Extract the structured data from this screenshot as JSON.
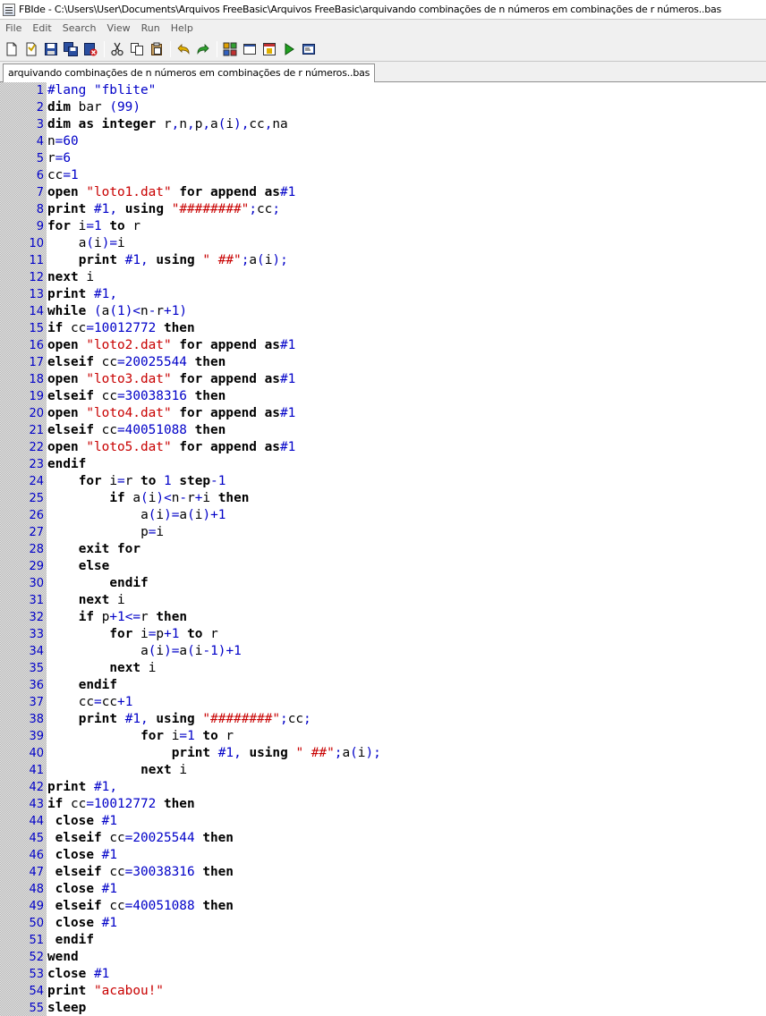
{
  "window": {
    "title": "FBIde - C:\\Users\\User\\Documents\\Arquivos FreeBasic\\Arquivos FreeBasic\\arquivando combinações de n números em combinações de r números..bas"
  },
  "menu": [
    "File",
    "Edit",
    "Search",
    "View",
    "Run",
    "Help"
  ],
  "toolbar": {
    "buttons": [
      "new-file-icon",
      "open-file-icon",
      "save-icon",
      "save-all-icon",
      "close-file-icon",
      "cut-icon",
      "copy-icon",
      "paste-icon",
      "undo-icon",
      "redo-icon",
      "compile-icon",
      "run-window-icon",
      "compile-run-icon",
      "run-icon",
      "console-icon"
    ]
  },
  "tab": {
    "label": "arquivando combinações de n números em combinações de r números..bas"
  },
  "colors": {
    "keyword": "#000000",
    "string": "#c80000",
    "number": "#0000c8",
    "line_number": "#0000c8"
  },
  "code_lines": [
    "#lang \"fblite\"",
    "dim bar (99)",
    "dim as integer r,n,p,a(i),cc,na",
    "n=60",
    "r=6",
    "cc=1",
    "open \"loto1.dat\" for append as#1",
    "print #1, using \"########\";cc;",
    "for i=1 to r",
    "    a(i)=i",
    "    print #1, using \" ##\";a(i);",
    "next i",
    "print #1,",
    "while (a(1)<n-r+1)",
    "if cc=10012772 then",
    "open \"loto2.dat\" for append as#1",
    "elseif cc=20025544 then",
    "open \"loto3.dat\" for append as#1",
    "elseif cc=30038316 then",
    "open \"loto4.dat\" for append as#1",
    "elseif cc=40051088 then",
    "open \"loto5.dat\" for append as#1",
    "endif",
    "    for i=r to 1 step-1",
    "        if a(i)<n-r+i then",
    "            a(i)=a(i)+1",
    "            p=i",
    "    exit for",
    "    else",
    "        endif",
    "    next i",
    "    if p+1<=r then",
    "        for i=p+1 to r",
    "            a(i)=a(i-1)+1",
    "        next i",
    "    endif",
    "    cc=cc+1",
    "    print #1, using \"########\";cc;",
    "            for i=1 to r",
    "                print #1, using \" ##\";a(i);",
    "            next i",
    "print #1,",
    "if cc=10012772 then",
    " close #1",
    " elseif cc=20025544 then",
    " close #1",
    " elseif cc=30038316 then",
    " close #1",
    " elseif cc=40051088 then",
    " close #1",
    " endif",
    "wend",
    "close #1",
    "print \"acabou!\"",
    "sleep"
  ]
}
